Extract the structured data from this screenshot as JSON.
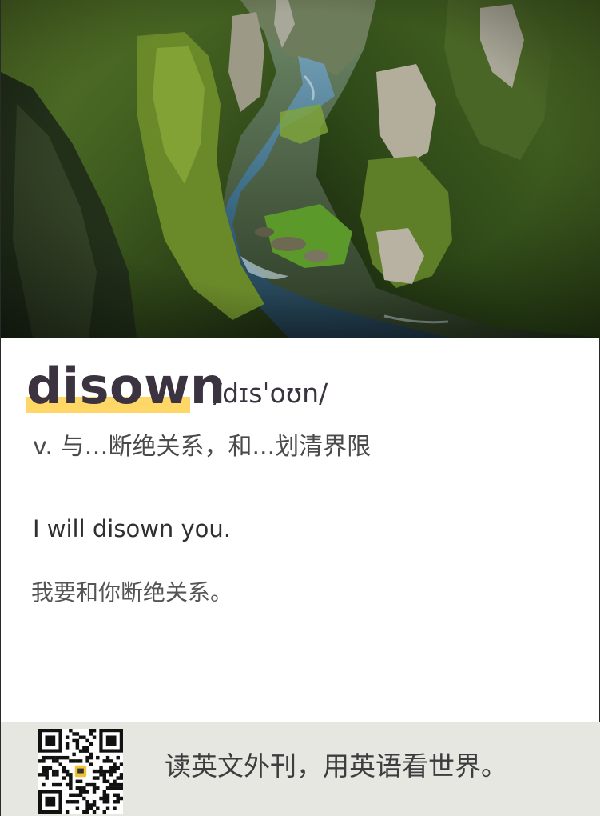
{
  "hero": {
    "image_name": "mossy-canyon-river-photo"
  },
  "entry": {
    "word": "disown",
    "phonetic": "/dɪsˈoʊn/",
    "definition": "v. 与…断绝关系，和...划清界限",
    "example_en": "I will disown you.",
    "example_zh": "我要和你断绝关系。"
  },
  "footer": {
    "qr_name": "qr-code",
    "slogan": "读英文外刊，用英语看世界。"
  },
  "colors": {
    "highlight": "#ffd766",
    "word": "#3b3440",
    "footer_bg": "#e7e7e2"
  }
}
